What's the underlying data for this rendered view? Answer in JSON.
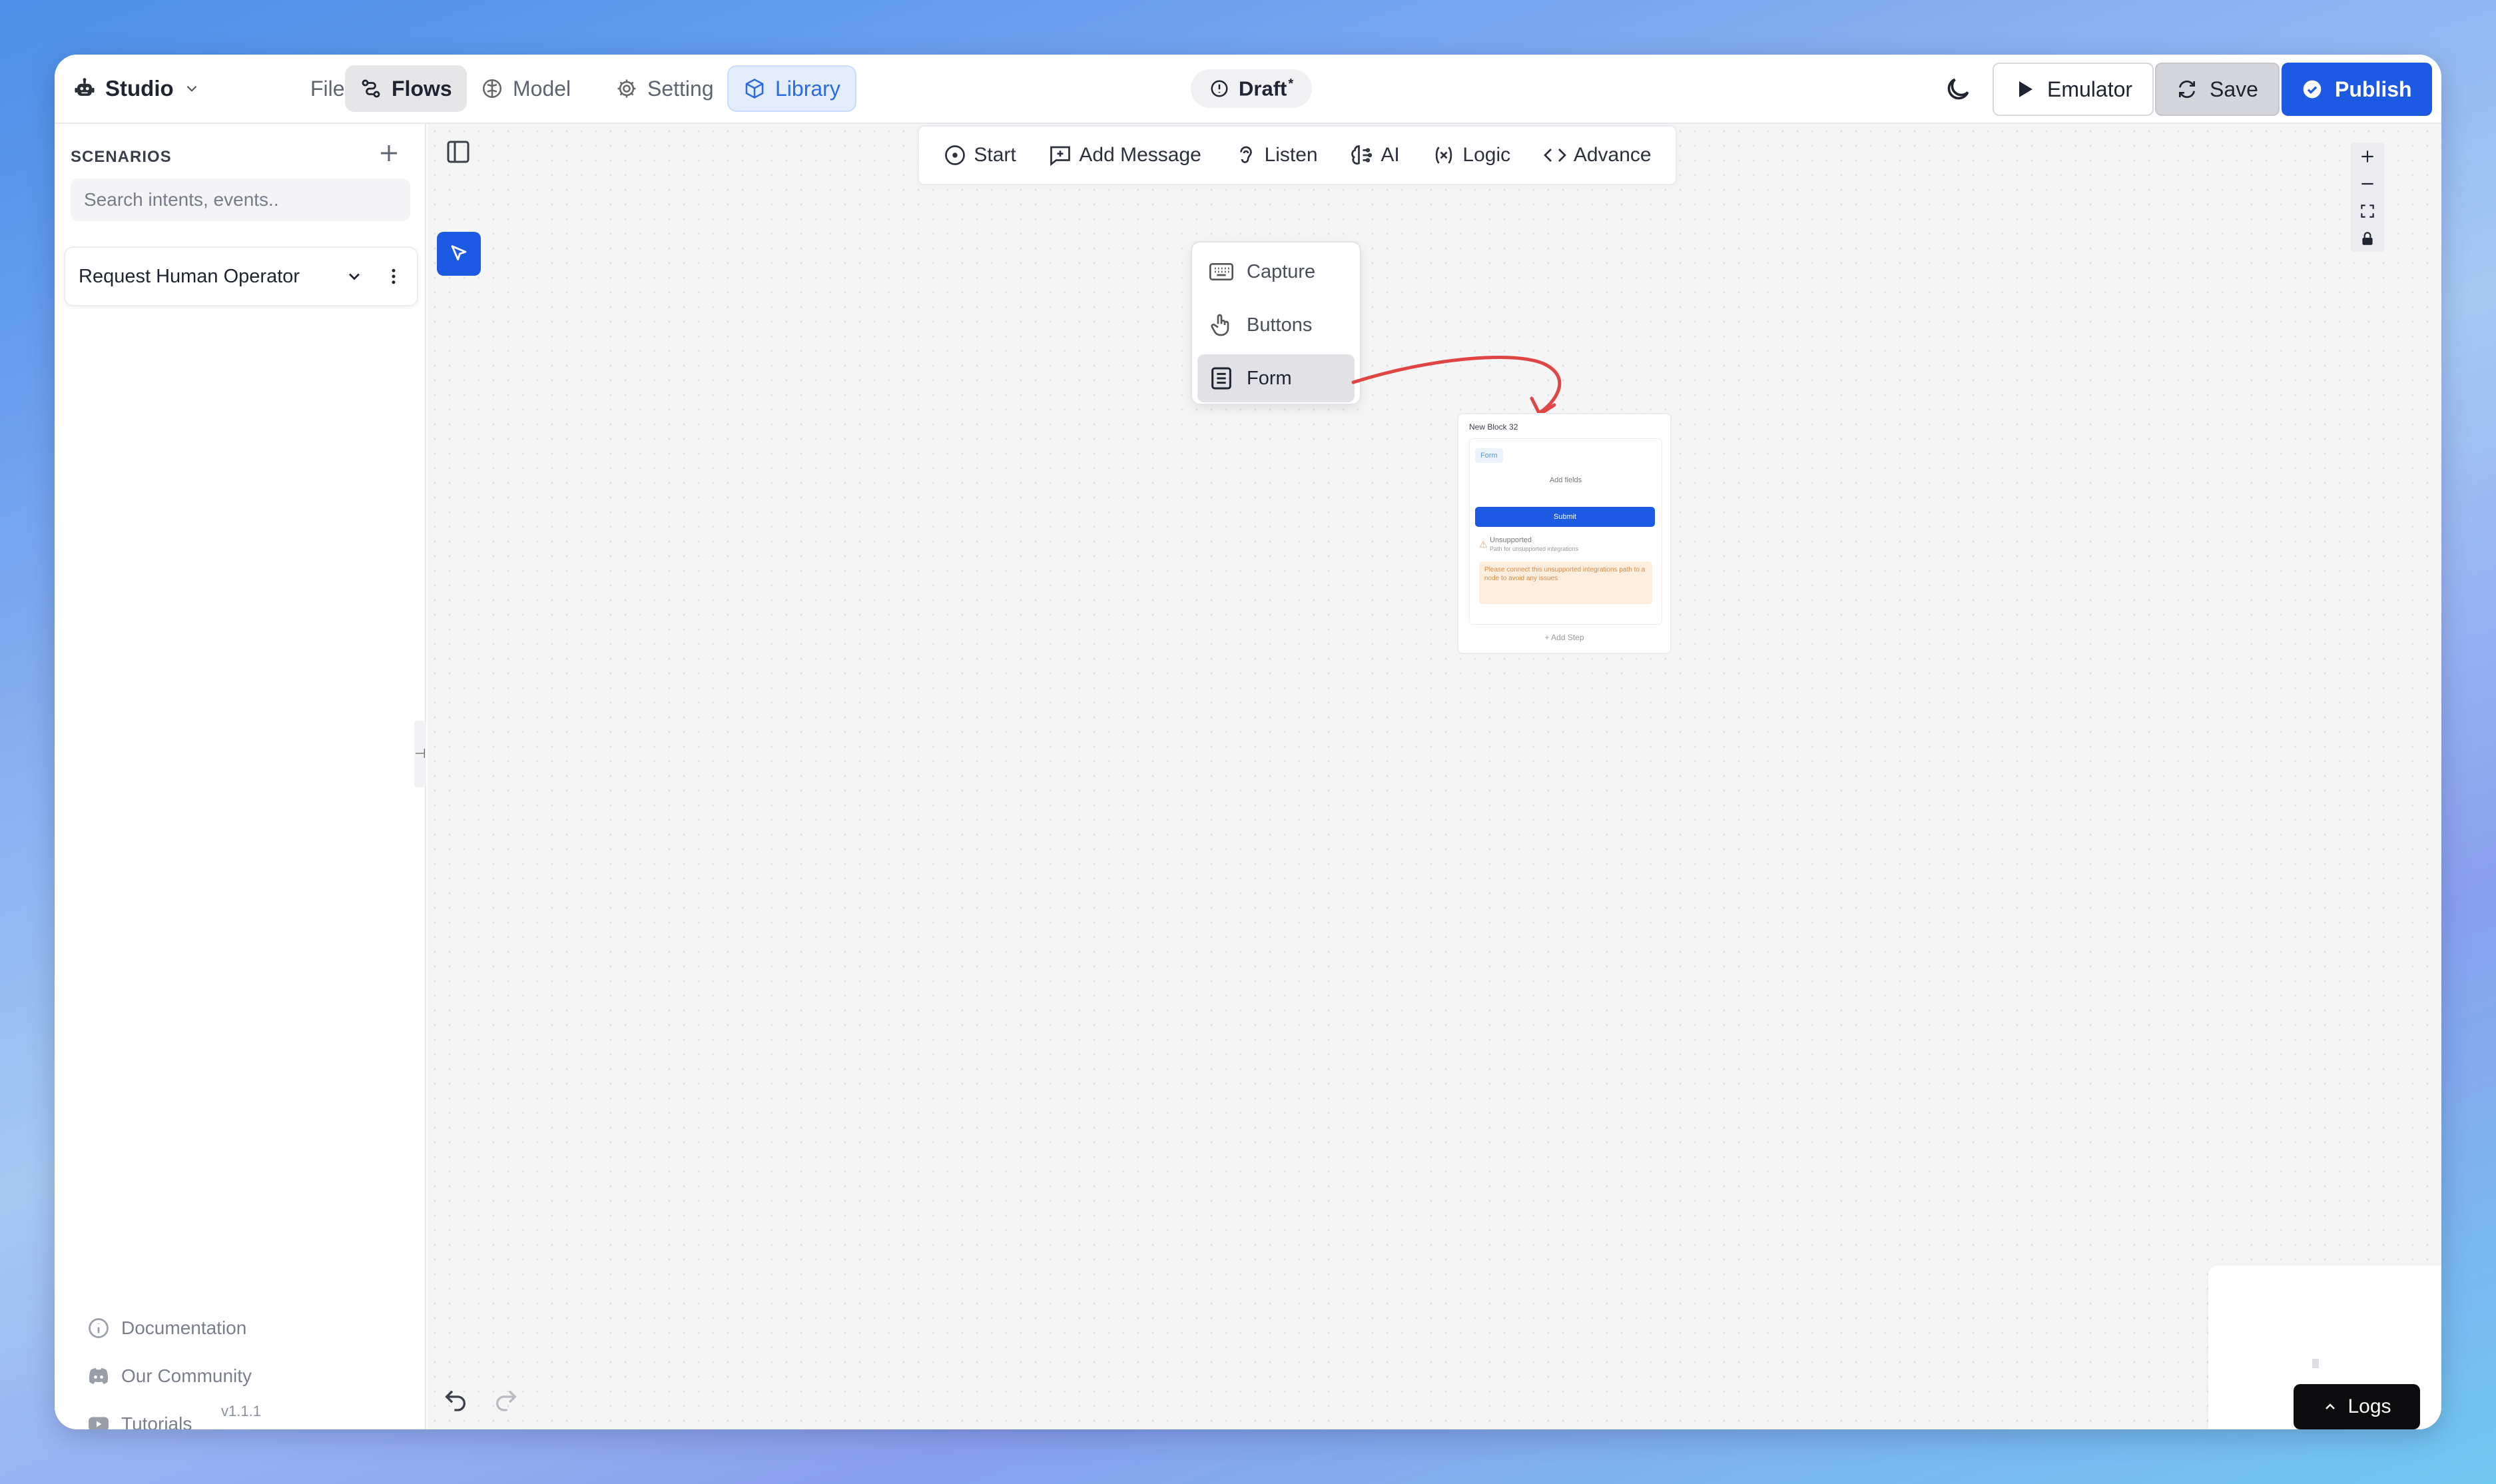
{
  "topbar": {
    "app_name": "Studio",
    "file_label": "File",
    "flows_label": "Flows",
    "model_label": "Model",
    "setting_label": "Setting",
    "library_label": "Library",
    "draft_label": "Draft",
    "draft_marker": "*",
    "emulator_label": "Emulator",
    "save_label": "Save",
    "publish_label": "Publish"
  },
  "sidebar": {
    "scenarios_title": "SCENARIOS",
    "search_placeholder": "Search intents, events..",
    "scenario_item": "Request Human Operator",
    "footer_links": [
      "Documentation",
      "Our Community",
      "Tutorials"
    ],
    "version": "v1.1.1"
  },
  "toolbar": {
    "items": [
      "Start",
      "Add Message",
      "Listen",
      "AI",
      "Logic",
      "Advance"
    ]
  },
  "listen_menu": {
    "items": [
      "Capture",
      "Buttons",
      "Form"
    ],
    "selected": "Form"
  },
  "block": {
    "title": "New Block 32",
    "form_chip": "Form",
    "add_fields": "Add fields",
    "submit_label": "Submit",
    "unsupported_title": "Unsupported",
    "unsupported_sub": "Path for unsupported integrations",
    "warning_text": "Please connect this unsupported integrations path to a node to avoid any issues",
    "add_step": "+ Add Step"
  },
  "logs_label": "Logs",
  "colors": {
    "accent": "#1d5ae2",
    "annotation_arrow": "#e04545"
  }
}
